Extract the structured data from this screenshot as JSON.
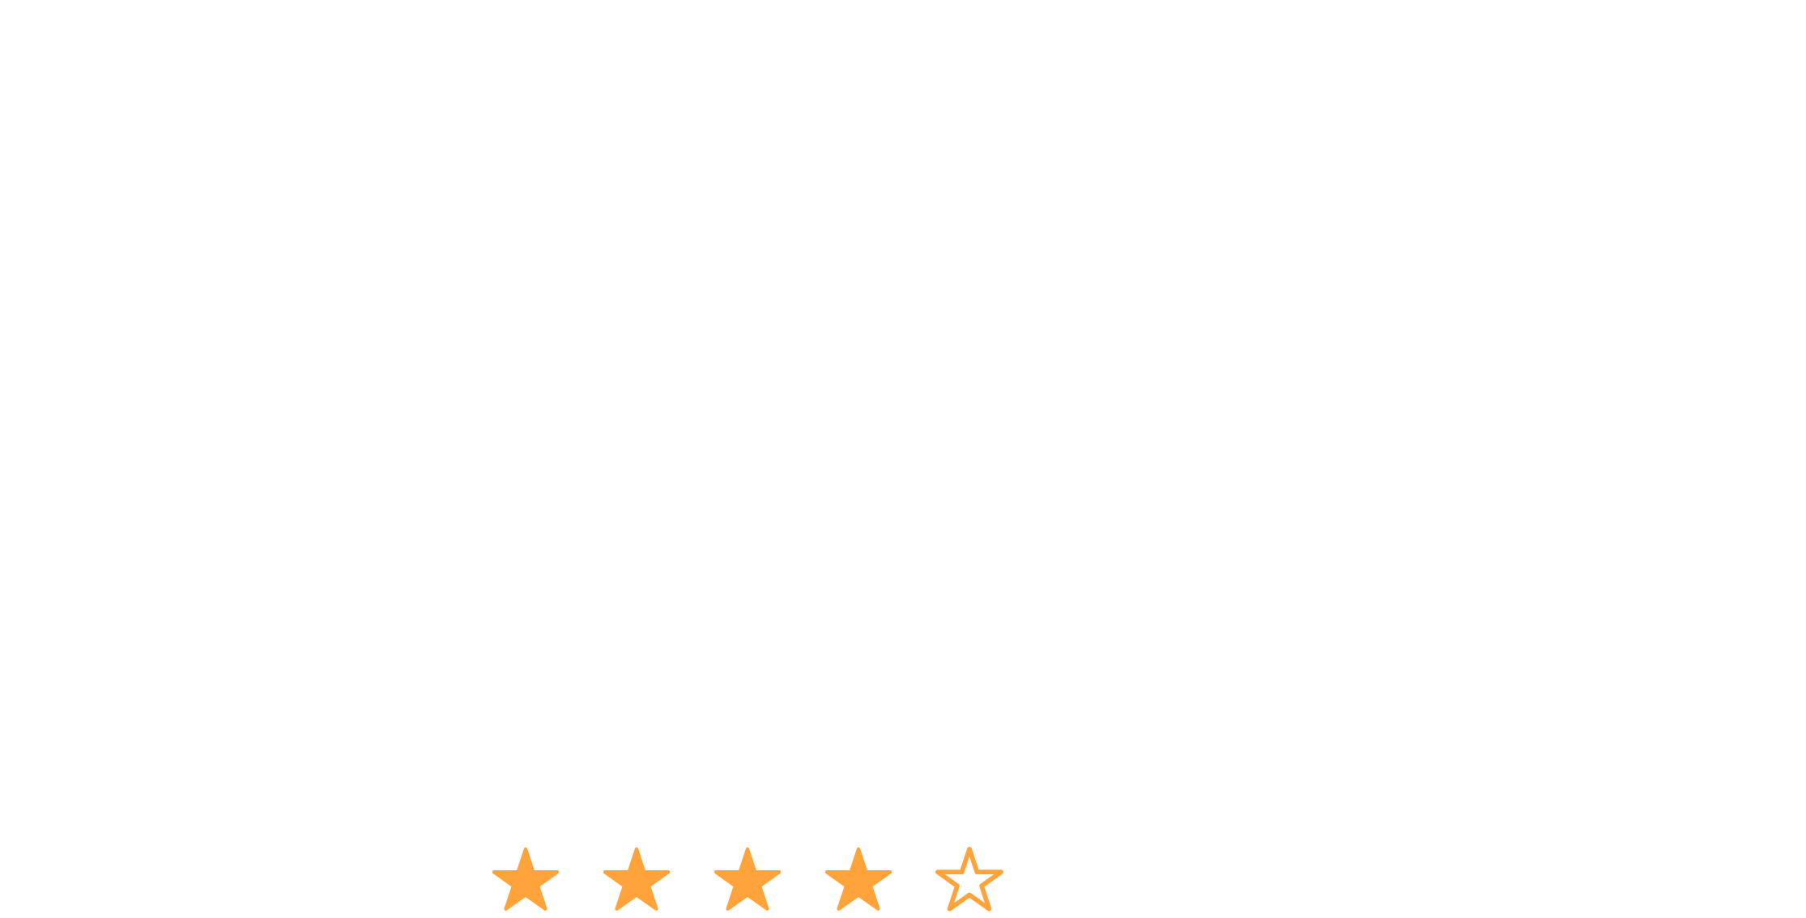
{
  "rating": {
    "value": 4,
    "max": 5,
    "color": "#FFA33A",
    "stars": [
      {
        "icon": "star-filled-icon",
        "filled": true
      },
      {
        "icon": "star-filled-icon",
        "filled": true
      },
      {
        "icon": "star-filled-icon",
        "filled": true
      },
      {
        "icon": "star-filled-icon",
        "filled": true
      },
      {
        "icon": "star-outline-icon",
        "filled": false
      }
    ]
  }
}
